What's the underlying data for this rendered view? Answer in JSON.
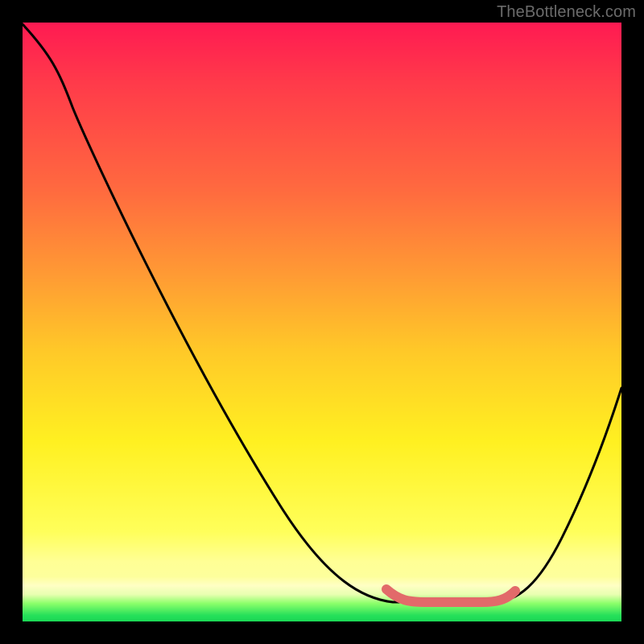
{
  "watermark": "TheBottleneck.com",
  "colors": {
    "top": "#ff1a52",
    "mid": "#ffc928",
    "bottom_green": "#25e05a",
    "curve": "#000000",
    "low_highlight": "#e26a6a",
    "frame": "#000000",
    "watermark_text": "#6b6b6b"
  },
  "chart_data": {
    "type": "line",
    "title": "",
    "xlabel": "",
    "ylabel": "",
    "xlim": [
      0,
      100
    ],
    "ylim": [
      0,
      100
    ],
    "grid": false,
    "legend": false,
    "background": "heat-gradient-vertical",
    "annotations": [
      {
        "name": "optimal-range-marker",
        "x_range": [
          61,
          82
        ],
        "y": 3,
        "color": "#e26a6a"
      }
    ],
    "series": [
      {
        "name": "black-curve",
        "color": "#000000",
        "x": [
          0,
          4,
          8,
          12,
          20,
          30,
          40,
          50,
          57,
          62,
          65,
          70,
          75,
          79,
          82,
          86,
          90,
          94,
          97,
          100
        ],
        "y": [
          100,
          95,
          88,
          80,
          65,
          48,
          32,
          17,
          10,
          5,
          3,
          3,
          3,
          3,
          5,
          10,
          18,
          28,
          35,
          40
        ]
      }
    ]
  }
}
